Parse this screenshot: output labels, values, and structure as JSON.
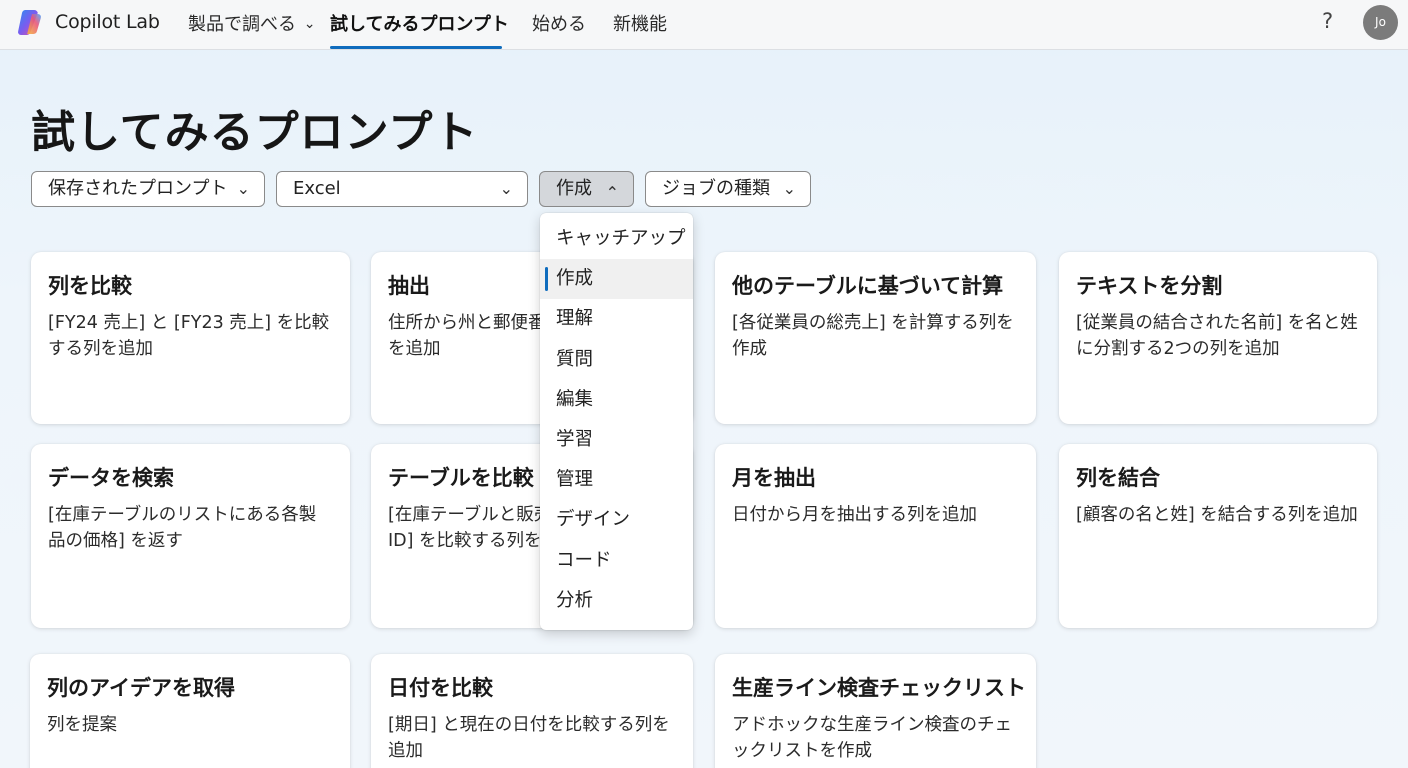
{
  "nav": {
    "brand": "Copilot Lab",
    "items": [
      "製品で調べる",
      "試してみるプロンプト",
      "始める",
      "新機能"
    ],
    "dropdown_chevron": "chevron-down-icon",
    "help": "?",
    "avatar_initials": "Jo"
  },
  "page": {
    "title": "試してみるプロンプト"
  },
  "filters": {
    "saved": "保存されたプロンプト",
    "app": "Excel",
    "task": "作成",
    "job": "ジョブの種類"
  },
  "dropdown": {
    "items": [
      "キャッチアップ",
      "作成",
      "理解",
      "質問",
      "編集",
      "学習",
      "管理",
      "デザイン",
      "コード",
      "分析"
    ],
    "selected": "作成"
  },
  "cards": [
    {
      "title": "列を比較",
      "desc": "[FY24 売上] と [FY23 売上] を比較する列を追加"
    },
    {
      "title": "抽出",
      "desc": "住所から州と郵便番号を抽出する列を追加"
    },
    {
      "title": "他のテーブルに基づいて計算",
      "desc": "[各従業員の総売上] を計算する列を作成"
    },
    {
      "title": "テキストを分割",
      "desc": "[従業員の結合された名前] を名と姓に分割する2つの列を追加"
    },
    {
      "title": "データを検索",
      "desc": "[在庫テーブルのリストにある各製品の価格] を返す"
    },
    {
      "title": "テーブルを比較",
      "desc": "[在庫テーブルと販売テーブルの製品 ID] を比較する列を追加"
    },
    {
      "title": "月を抽出",
      "desc": "日付から月を抽出する列を追加"
    },
    {
      "title": "列を結合",
      "desc": "[顧客の名と姓] を結合する列を追加"
    },
    {
      "title": "列のアイデアを取得",
      "desc": "列を提案"
    },
    {
      "title": "日付を比較",
      "desc": "[期日] と現在の日付を比較する列を追加"
    },
    {
      "title": "生産ライン検査チェックリスト",
      "desc": "アドホックな生産ライン検査のチェックリストを作成"
    }
  ],
  "colors": {
    "accent": "#0f6cbd",
    "background": "#e9f2fa"
  }
}
